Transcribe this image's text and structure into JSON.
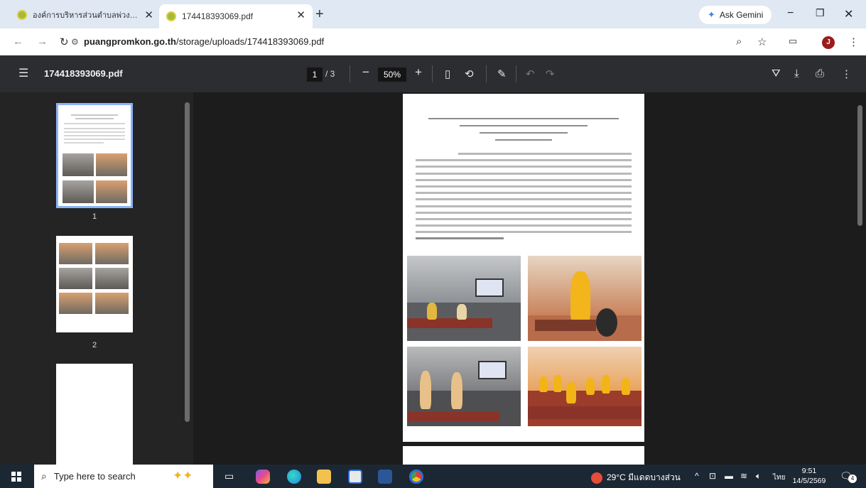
{
  "tabs": [
    {
      "title": "องค์การบริหารส่วนตำบลพ่วงพรมคร",
      "active": false
    },
    {
      "title": "174418393069.pdf",
      "active": true
    }
  ],
  "ask_gemini": "Ask Gemini",
  "address": {
    "host": "puangpromkon.go.th",
    "path": "/storage/uploads/174418393069.pdf"
  },
  "avatar_letter": "J",
  "pdf": {
    "file_name": "174418393069.pdf",
    "current_page": "1",
    "total_pages": "/ 3",
    "zoom": "50%"
  },
  "thumbnails": [
    {
      "page": "1"
    },
    {
      "page": "2"
    }
  ],
  "taskbar": {
    "search_placeholder": "Type here to search",
    "weather": "29°C มีแดดบางส่วน",
    "lang": "ไทย",
    "time": "9:51",
    "date": "14/5/2569",
    "notifications": "4"
  },
  "colors": {
    "accent": "#8ab4f8",
    "toolbar": "#2c2d30",
    "taskbar": "#1c2734"
  }
}
